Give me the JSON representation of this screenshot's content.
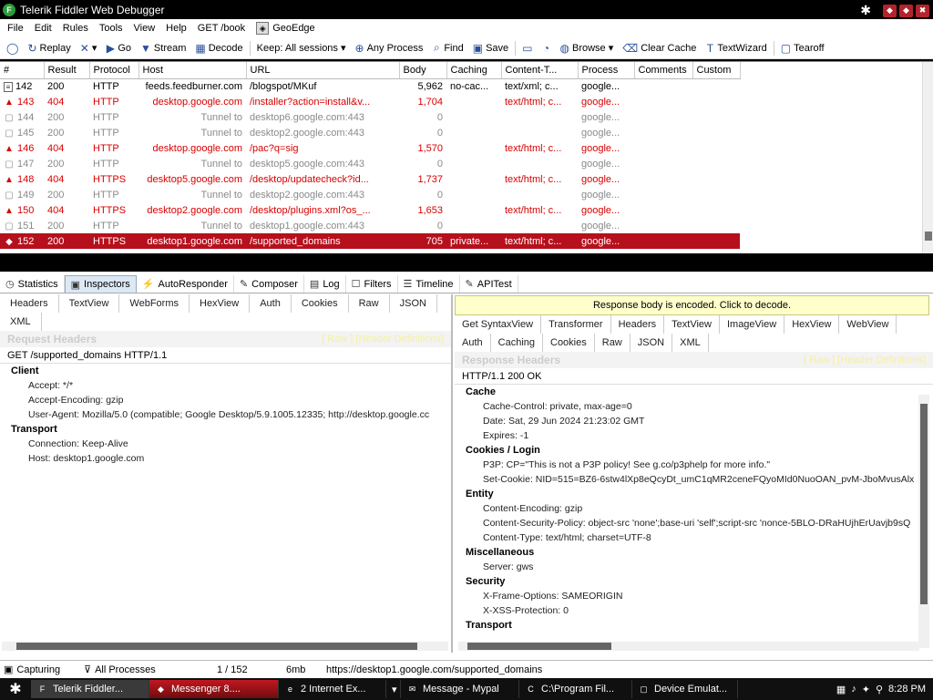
{
  "window": {
    "title": "Telerik Fiddler Web Debugger",
    "icon_letter": "F",
    "controls": [
      "✱",
      "◆",
      "◆",
      "✖"
    ]
  },
  "menu": {
    "items": [
      "File",
      "Edit",
      "Rules",
      "Tools",
      "View",
      "Help",
      "GET /book"
    ],
    "geoedge": "GeoEdge"
  },
  "toolbar": {
    "items": [
      {
        "icon": "chat-icon",
        "label": ""
      },
      {
        "icon": "replay-icon",
        "label": "Replay"
      },
      {
        "icon": "x-icon",
        "label": "▾"
      },
      {
        "icon": "go-icon",
        "label": "Go"
      },
      {
        "icon": "stream-icon",
        "label": "Stream"
      },
      {
        "icon": "decode-icon",
        "label": "Decode"
      },
      {
        "icon": "",
        "label": "Keep: All sessions ▾"
      },
      {
        "icon": "process-icon",
        "label": "Any Process"
      },
      {
        "icon": "find-icon",
        "label": "Find"
      },
      {
        "icon": "save-icon",
        "label": "Save"
      },
      {
        "icon": "camera-icon",
        "label": ""
      },
      {
        "icon": "timer-icon",
        "label": ""
      },
      {
        "icon": "browse-icon",
        "label": "Browse ▾"
      },
      {
        "icon": "clear-cache-icon",
        "label": "Clear Cache"
      },
      {
        "icon": "textwizard-icon",
        "label": "TextWizard"
      },
      {
        "icon": "tearoff-icon",
        "label": "Tearoff"
      }
    ]
  },
  "sessions": {
    "columns": [
      "#",
      "Result",
      "Protocol",
      "Host",
      "URL",
      "Body",
      "Caching",
      "Content-T...",
      "Process",
      "Comments",
      "Custom"
    ],
    "rows": [
      {
        "num": "142",
        "result": "200",
        "protocol": "HTTP",
        "host": "feeds.feedburner.com",
        "url": "/blogspot/MKuf",
        "body": "5,962",
        "caching": "no-cac...",
        "ctype": "text/xml; c...",
        "process": "google...",
        "kind": "normal",
        "icon": "doc"
      },
      {
        "num": "143",
        "result": "404",
        "protocol": "HTTP",
        "host": "desktop.google.com",
        "url": "/installer?action=install&v...",
        "body": "1,704",
        "caching": "",
        "ctype": "text/html; c...",
        "process": "google...",
        "kind": "err",
        "icon": "warn"
      },
      {
        "num": "144",
        "result": "200",
        "protocol": "HTTP",
        "host": "Tunnel to",
        "url": "desktop6.google.com:443",
        "body": "0",
        "caching": "",
        "ctype": "",
        "process": "google...",
        "kind": "gray",
        "icon": "lock"
      },
      {
        "num": "145",
        "result": "200",
        "protocol": "HTTP",
        "host": "Tunnel to",
        "url": "desktop2.google.com:443",
        "body": "0",
        "caching": "",
        "ctype": "",
        "process": "google...",
        "kind": "gray",
        "icon": "lock"
      },
      {
        "num": "146",
        "result": "404",
        "protocol": "HTTP",
        "host": "desktop.google.com",
        "url": "/pac?q=sig",
        "body": "1,570",
        "caching": "",
        "ctype": "text/html; c...",
        "process": "google...",
        "kind": "err",
        "icon": "warn"
      },
      {
        "num": "147",
        "result": "200",
        "protocol": "HTTP",
        "host": "Tunnel to",
        "url": "desktop5.google.com:443",
        "body": "0",
        "caching": "",
        "ctype": "",
        "process": "google...",
        "kind": "gray",
        "icon": "lock"
      },
      {
        "num": "148",
        "result": "404",
        "protocol": "HTTPS",
        "host": "desktop5.google.com",
        "url": "/desktop/updatecheck?id...",
        "body": "1,737",
        "caching": "",
        "ctype": "text/html; c...",
        "process": "google...",
        "kind": "err",
        "icon": "warn"
      },
      {
        "num": "149",
        "result": "200",
        "protocol": "HTTP",
        "host": "Tunnel to",
        "url": "desktop2.google.com:443",
        "body": "0",
        "caching": "",
        "ctype": "",
        "process": "google...",
        "kind": "gray",
        "icon": "lock"
      },
      {
        "num": "150",
        "result": "404",
        "protocol": "HTTPS",
        "host": "desktop2.google.com",
        "url": "/desktop/plugins.xml?os_...",
        "body": "1,653",
        "caching": "",
        "ctype": "text/html; c...",
        "process": "google...",
        "kind": "err",
        "icon": "warn"
      },
      {
        "num": "151",
        "result": "200",
        "protocol": "HTTP",
        "host": "Tunnel to",
        "url": "desktop1.google.com:443",
        "body": "0",
        "caching": "",
        "ctype": "",
        "process": "google...",
        "kind": "gray",
        "icon": "lock"
      },
      {
        "num": "152",
        "result": "200",
        "protocol": "HTTPS",
        "host": "desktop1.google.com",
        "url": "/supported_domains",
        "body": "705",
        "caching": "private...",
        "ctype": "text/html; c...",
        "process": "google...",
        "kind": "sel",
        "icon": "arrows"
      }
    ]
  },
  "main_tabs": [
    {
      "icon": "stats-icon",
      "glyph": "◷",
      "label": "Statistics"
    },
    {
      "icon": "inspectors-icon",
      "glyph": "▣",
      "label": "Inspectors"
    },
    {
      "icon": "autoresponder-icon",
      "glyph": "⚡",
      "label": "AutoResponder"
    },
    {
      "icon": "composer-icon",
      "glyph": "✎",
      "label": "Composer"
    },
    {
      "icon": "log-icon",
      "glyph": "▤",
      "label": "Log"
    },
    {
      "icon": "filters-icon",
      "glyph": "☐",
      "label": "Filters"
    },
    {
      "icon": "timeline-icon",
      "glyph": "☰",
      "label": "Timeline"
    },
    {
      "icon": "apitest-icon",
      "glyph": "✎",
      "label": "APITest"
    }
  ],
  "request": {
    "subtabs": [
      "Headers",
      "TextView",
      "WebForms",
      "HexView",
      "Auth",
      "Cookies",
      "Raw",
      "JSON",
      "XML"
    ],
    "header_title": "Request Headers",
    "header_links": "[ Raw ]   [Header Definitions]",
    "request_line": "GET /supported_domains HTTP/1.1",
    "groups": [
      {
        "name": "Client",
        "items": [
          "Accept: */*",
          "Accept-Encoding: gzip",
          "User-Agent: Mozilla/5.0 (compatible; Google Desktop/5.9.1005.12335; http://desktop.google.cc"
        ]
      },
      {
        "name": "Transport",
        "items": [
          "Connection: Keep-Alive",
          "Host: desktop1.google.com"
        ]
      }
    ]
  },
  "response": {
    "notice": "Response body is encoded. Click to decode.",
    "subtabs": [
      "Get SyntaxView",
      "Transformer",
      "Headers",
      "TextView",
      "ImageView",
      "HexView",
      "WebView",
      "Auth",
      "Caching",
      "Cookies",
      "Raw",
      "JSON",
      "XML"
    ],
    "header_title": "Response Headers",
    "header_links": "[ Raw ]   [Header Definitions]",
    "status_line": "HTTP/1.1 200 OK",
    "groups": [
      {
        "name": "Cache",
        "items": [
          "Cache-Control: private, max-age=0",
          "Date: Sat, 29 Jun 2024 21:23:02 GMT",
          "Expires: -1"
        ]
      },
      {
        "name": "Cookies / Login",
        "items": [
          "P3P: CP=\"This is not a P3P policy! See g.co/p3phelp for more info.\"",
          "Set-Cookie: NID=515=BZ6-6stw4lXp8eQcyDt_umC1qMR2ceneFQyoMId0NuoOAN_pvM-JboMvusAlx"
        ]
      },
      {
        "name": "Entity",
        "items": [
          "Content-Encoding: gzip",
          "Content-Security-Policy: object-src 'none';base-uri 'self';script-src 'nonce-5BLO-DRaHUjhErUavjb9sQ",
          "Content-Type: text/html; charset=UTF-8"
        ]
      },
      {
        "name": "Miscellaneous",
        "items": [
          "Server: gws"
        ]
      },
      {
        "name": "Security",
        "items": [
          "X-Frame-Options: SAMEORIGIN",
          "X-XSS-Protection: 0"
        ]
      },
      {
        "name": "Transport",
        "items": []
      }
    ]
  },
  "status": {
    "capturing": "Capturing",
    "processes": "All Processes",
    "count": "1 / 152",
    "memory": "6mb",
    "url": "https://desktop1.google.com/supported_domains"
  },
  "taskbar": {
    "start": "✱",
    "tasks": [
      {
        "label": "Telerik Fiddler...",
        "icon": "fiddler-icon",
        "glyph": "F",
        "style": "active"
      },
      {
        "label": "Messenger 8....",
        "icon": "messenger-icon",
        "glyph": "◆",
        "style": "msg"
      },
      {
        "label": "2 Internet Ex...",
        "icon": "ie-icon",
        "glyph": "e",
        "style": ""
      },
      {
        "label": "▾",
        "icon": "",
        "glyph": "",
        "style": ""
      },
      {
        "label": "Message - Mypal",
        "icon": "mypal-icon",
        "glyph": "✉",
        "style": ""
      },
      {
        "label": "C:\\Program Fil...",
        "icon": "cmd-icon",
        "glyph": "C",
        "style": ""
      },
      {
        "label": "Device Emulat...",
        "icon": "device-icon",
        "glyph": "▢",
        "style": ""
      }
    ],
    "clock": "8:28 PM"
  },
  "colors": {
    "selected_row": "#b6101d",
    "error_text": "#d90000",
    "notice_bg": "#ffffcc"
  }
}
